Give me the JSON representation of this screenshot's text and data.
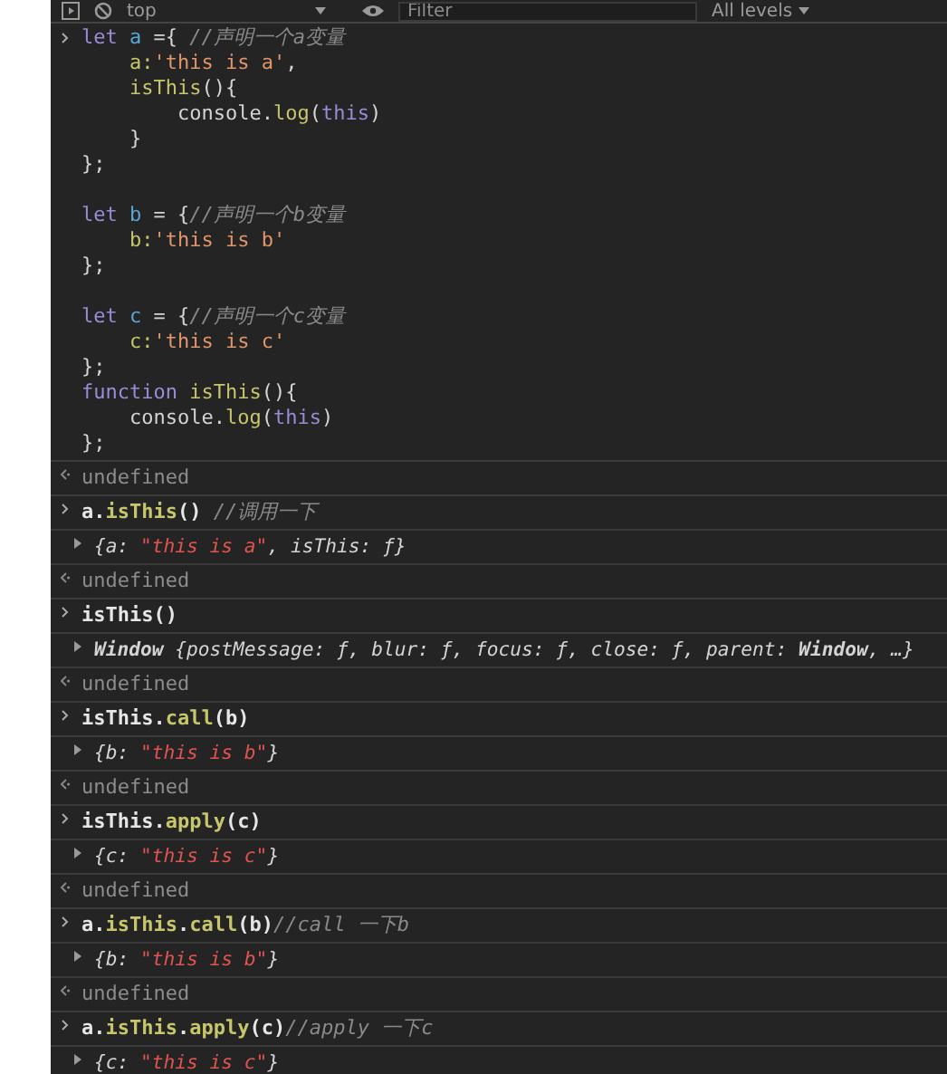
{
  "toolbar": {
    "context": "top",
    "filter": {
      "placeholder": "Filter"
    },
    "levels": "All levels"
  },
  "entries": [
    {
      "kind": "code",
      "lines": [
        {
          "gap_before": false,
          "tokens": [
            {
              "kind": "kw",
              "text": "let "
            },
            {
              "kind": "var",
              "text": "a"
            },
            {
              "kind": "plain",
              "text": " ={ "
            },
            {
              "kind": "comment",
              "text": "//声明一个a变量"
            }
          ]
        },
        {
          "gap_before": false,
          "tokens": [
            {
              "kind": "prop",
              "text": "    a:"
            },
            {
              "kind": "str",
              "text": "'this is a'"
            },
            {
              "kind": "plain",
              "text": ","
            }
          ]
        },
        {
          "gap_before": false,
          "tokens": [
            {
              "kind": "prop",
              "text": "    isThis"
            },
            {
              "kind": "plain",
              "text": "(){"
            }
          ]
        },
        {
          "gap_before": false,
          "tokens": [
            {
              "kind": "plain",
              "text": "        console."
            },
            {
              "kind": "method",
              "text": "log"
            },
            {
              "kind": "plain",
              "text": "("
            },
            {
              "kind": "kw",
              "text": "this"
            },
            {
              "kind": "plain",
              "text": ")"
            }
          ]
        },
        {
          "gap_before": false,
          "tokens": [
            {
              "kind": "plain",
              "text": "    }"
            }
          ]
        },
        {
          "gap_before": false,
          "tokens": [
            {
              "kind": "plain",
              "text": "};"
            }
          ]
        },
        {
          "gap_before": true,
          "tokens": [
            {
              "kind": "kw",
              "text": "let "
            },
            {
              "kind": "var",
              "text": "b"
            },
            {
              "kind": "plain",
              "text": " = {"
            },
            {
              "kind": "comment",
              "text": "//声明一个b变量"
            }
          ]
        },
        {
          "gap_before": false,
          "tokens": [
            {
              "kind": "prop",
              "text": "    b:"
            },
            {
              "kind": "str",
              "text": "'this is b'"
            }
          ]
        },
        {
          "gap_before": false,
          "tokens": [
            {
              "kind": "plain",
              "text": "};"
            }
          ]
        },
        {
          "gap_before": true,
          "tokens": [
            {
              "kind": "kw",
              "text": "let "
            },
            {
              "kind": "var",
              "text": "c"
            },
            {
              "kind": "plain",
              "text": " = {"
            },
            {
              "kind": "comment",
              "text": "//声明一个c变量"
            }
          ]
        },
        {
          "gap_before": false,
          "tokens": [
            {
              "kind": "prop",
              "text": "    c:"
            },
            {
              "kind": "str",
              "text": "'this is c'"
            }
          ]
        },
        {
          "gap_before": false,
          "tokens": [
            {
              "kind": "plain",
              "text": "};"
            }
          ]
        },
        {
          "gap_before": false,
          "tokens": [
            {
              "kind": "kw",
              "text": "function "
            },
            {
              "kind": "prop",
              "text": "isThis"
            },
            {
              "kind": "plain",
              "text": "(){"
            }
          ]
        },
        {
          "gap_before": false,
          "tokens": [
            {
              "kind": "plain",
              "text": "    console."
            },
            {
              "kind": "method",
              "text": "log"
            },
            {
              "kind": "plain",
              "text": "("
            },
            {
              "kind": "kw",
              "text": "this"
            },
            {
              "kind": "plain",
              "text": ")"
            }
          ]
        },
        {
          "gap_before": false,
          "tokens": [
            {
              "kind": "plain",
              "text": "};"
            }
          ]
        }
      ]
    },
    {
      "kind": "result",
      "text": "undefined"
    },
    {
      "kind": "command",
      "tokens": [
        {
          "kind": "plain",
          "text": "a."
        },
        {
          "kind": "method",
          "text": "isThis"
        },
        {
          "kind": "plain",
          "text": "() "
        },
        {
          "kind": "comment",
          "text": "//调用一下"
        }
      ]
    },
    {
      "kind": "object",
      "tokens": [
        {
          "kind": "punct",
          "text": "{a: "
        },
        {
          "kind": "strv",
          "text": "\"this is a\""
        },
        {
          "kind": "punct",
          "text": ", isThis: ƒ}"
        }
      ]
    },
    {
      "kind": "result",
      "text": "undefined"
    },
    {
      "kind": "command",
      "tokens": [
        {
          "kind": "plain",
          "text": "isThis()"
        }
      ]
    },
    {
      "kind": "object",
      "tokens": [
        {
          "kind": "cls",
          "text": "Window"
        },
        {
          "kind": "punct",
          "text": " {postMessage: ƒ, blur: ƒ, focus: ƒ, close: ƒ, parent: "
        },
        {
          "kind": "cls",
          "text": "Window"
        },
        {
          "kind": "punct",
          "text": ", …}"
        }
      ]
    },
    {
      "kind": "result",
      "text": "undefined"
    },
    {
      "kind": "command",
      "tokens": [
        {
          "kind": "plain",
          "text": "isThis."
        },
        {
          "kind": "method",
          "text": "call"
        },
        {
          "kind": "plain",
          "text": "(b)"
        }
      ]
    },
    {
      "kind": "object",
      "tokens": [
        {
          "kind": "punct",
          "text": "{b: "
        },
        {
          "kind": "strv",
          "text": "\"this is b\""
        },
        {
          "kind": "punct",
          "text": "}"
        }
      ]
    },
    {
      "kind": "result",
      "text": "undefined"
    },
    {
      "kind": "command",
      "tokens": [
        {
          "kind": "plain",
          "text": "isThis."
        },
        {
          "kind": "method",
          "text": "apply"
        },
        {
          "kind": "plain",
          "text": "(c)"
        }
      ]
    },
    {
      "kind": "object",
      "tokens": [
        {
          "kind": "punct",
          "text": "{c: "
        },
        {
          "kind": "strv",
          "text": "\"this is c\""
        },
        {
          "kind": "punct",
          "text": "}"
        }
      ]
    },
    {
      "kind": "result",
      "text": "undefined"
    },
    {
      "kind": "command",
      "tokens": [
        {
          "kind": "plain",
          "text": "a."
        },
        {
          "kind": "method",
          "text": "isThis"
        },
        {
          "kind": "plain",
          "text": "."
        },
        {
          "kind": "method",
          "text": "call"
        },
        {
          "kind": "plain",
          "text": "(b)"
        },
        {
          "kind": "comment",
          "text": "//call 一下b"
        }
      ]
    },
    {
      "kind": "object",
      "tokens": [
        {
          "kind": "punct",
          "text": "{b: "
        },
        {
          "kind": "strv",
          "text": "\"this is b\""
        },
        {
          "kind": "punct",
          "text": "}"
        }
      ]
    },
    {
      "kind": "result",
      "text": "undefined"
    },
    {
      "kind": "command",
      "tokens": [
        {
          "kind": "plain",
          "text": "a."
        },
        {
          "kind": "method",
          "text": "isThis"
        },
        {
          "kind": "plain",
          "text": "."
        },
        {
          "kind": "method",
          "text": "apply"
        },
        {
          "kind": "plain",
          "text": "(c)"
        },
        {
          "kind": "comment",
          "text": "//apply 一下c"
        }
      ]
    },
    {
      "kind": "object",
      "tokens": [
        {
          "kind": "punct",
          "text": "{c: "
        },
        {
          "kind": "strv",
          "text": "\"this is c\""
        },
        {
          "kind": "punct",
          "text": "}"
        }
      ]
    }
  ]
}
